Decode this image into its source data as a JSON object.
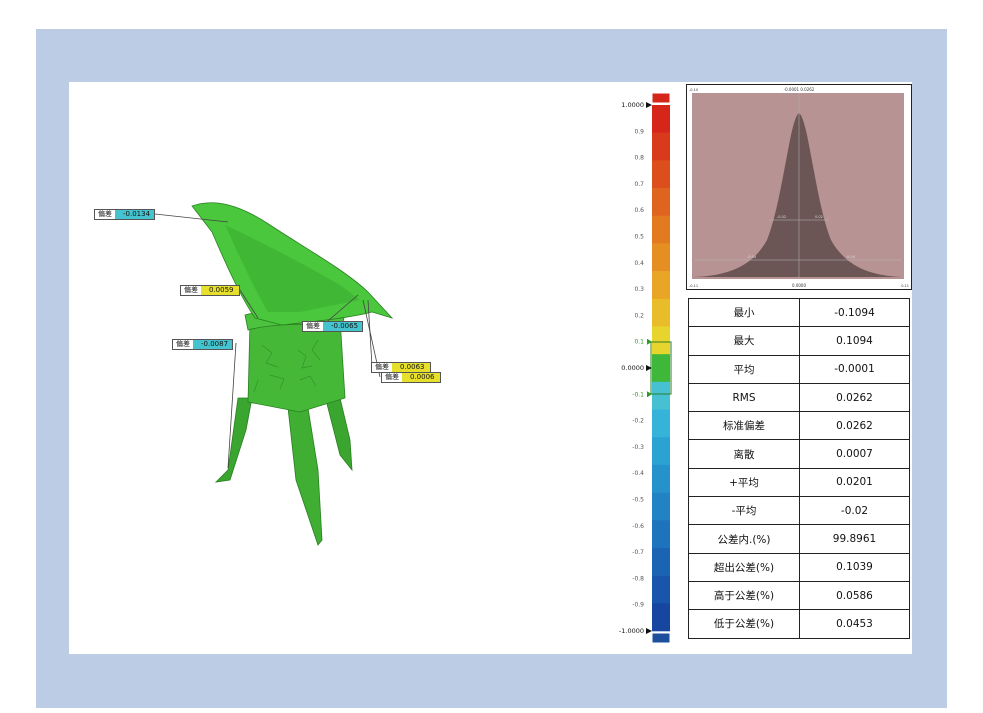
{
  "annotations": [
    {
      "label": "偏差",
      "value": "-0.0134",
      "color": "#45c4cf"
    },
    {
      "label": "偏差",
      "value": "0.0059",
      "color": "#e6df2c"
    },
    {
      "label": "偏差",
      "value": "-0.0065",
      "color": "#45c4cf"
    },
    {
      "label": "偏差",
      "value": "-0.0087",
      "color": "#45c4cf"
    },
    {
      "label": "偏差",
      "value": "0.0063",
      "color": "#e6df2c"
    },
    {
      "label": "偏差",
      "value": "0.0006",
      "color": "#e6df2c"
    }
  ],
  "colorbar": {
    "top_label": "1.0000",
    "mid_label": "0.0000",
    "bottom_label": "-1.0000",
    "ticks": [
      "0.9",
      "0.8",
      "0.7",
      "0.6",
      "0.5",
      "0.4",
      "0.3",
      "0.2",
      "0.1",
      "-0.1",
      "-0.2",
      "-0.3",
      "-0.4",
      "-0.5",
      "-0.6",
      "-0.7",
      "-0.8",
      "-0.9"
    ],
    "colors": [
      "#d6261a",
      "#d93a1b",
      "#dc4f1c",
      "#df641d",
      "#e27a1f",
      "#e58f22",
      "#e8a526",
      "#e9bd29",
      "#e7d42d",
      "#3fb83a",
      "#47c0d2",
      "#35b3d8",
      "#2aa2d2",
      "#2592cb",
      "#2183c4",
      "#1e73bd",
      "#1b64b4",
      "#1955aa",
      "#1746a0"
    ],
    "over_color": "#d6261a",
    "under_color": "#1e4f9c"
  },
  "histogram": {
    "top_left": "-0.10",
    "top_title": "-0.0001  0.0262",
    "bottom_left": "-0.11",
    "bottom_center": "0.0000",
    "bottom_right": "0.11",
    "left_small": "-0.04",
    "mid_left_small": "-0.02",
    "mid_right_small": "0.02",
    "right_small": "0.04"
  },
  "stats": [
    {
      "label": "最小",
      "value": "-0.1094"
    },
    {
      "label": "最大",
      "value": "0.1094"
    },
    {
      "label": "平均",
      "value": "-0.0001"
    },
    {
      "label": "RMS",
      "value": "0.0262"
    },
    {
      "label": "标准偏差",
      "value": "0.0262"
    },
    {
      "label": "离散",
      "value": "0.0007"
    },
    {
      "label": "+平均",
      "value": "0.0201"
    },
    {
      "label": "-平均",
      "value": "-0.02"
    },
    {
      "label": "公差内.(%)",
      "value": "99.8961"
    },
    {
      "label": "超出公差(%)",
      "value": "0.1039"
    },
    {
      "label": "高于公差(%)",
      "value": "0.0586"
    },
    {
      "label": "低于公差(%)",
      "value": "0.0453"
    }
  ]
}
